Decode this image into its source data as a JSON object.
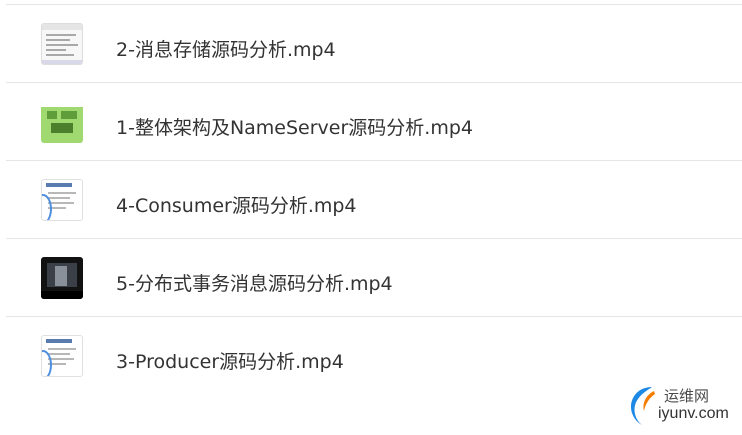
{
  "files": [
    {
      "name": "2-消息存储源码分析.mp4",
      "thumb": "doc-thumbnail"
    },
    {
      "name": "1-整体架构及NameServer源码分析.mp4",
      "thumb": "green-slide-thumbnail"
    },
    {
      "name": "4-Consumer源码分析.mp4",
      "thumb": "slide-thumbnail"
    },
    {
      "name": "5-分布式事务消息源码分析.mp4",
      "thumb": "dark-video-thumbnail"
    },
    {
      "name": "3-Producer源码分析.mp4",
      "thumb": "slide-thumbnail"
    }
  ],
  "watermark": {
    "cn": "运维网",
    "en": "iyunv.com",
    "logo_icon": "crescent-logo-icon",
    "colors": {
      "logo_blue": "#1e88e5",
      "logo_orange": "#f57c00"
    }
  },
  "colors": {
    "separator": "#e6e6e6",
    "text": "#333333"
  }
}
